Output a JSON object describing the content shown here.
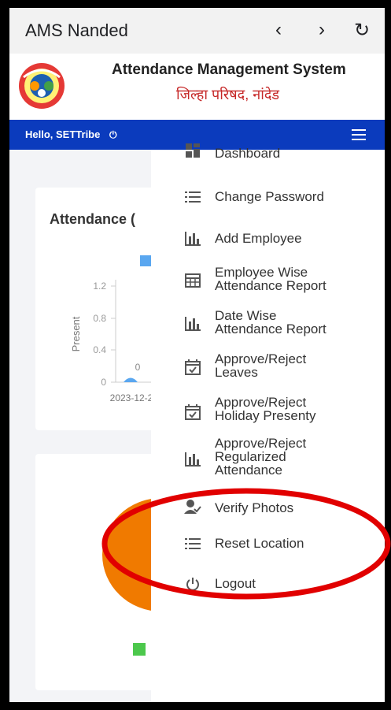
{
  "browser": {
    "title": "AMS Nanded",
    "back_glyph": "‹",
    "forward_glyph": "›",
    "reload_glyph": "↻"
  },
  "header": {
    "title": "Attendance Management System",
    "subtitle": "जिल्हा परिषद, नांदेड"
  },
  "topbar": {
    "greeting": "Hello, SETTribe",
    "power_glyph": "⏻"
  },
  "background": {
    "card_title": "Attendance (",
    "chart": {
      "y_ticks": [
        "1.2",
        "0.8",
        "0.4",
        "0"
      ],
      "ylabel": "Present",
      "x_tick": "2023-12-2",
      "point_label": "0"
    }
  },
  "menu": {
    "items": [
      {
        "icon": "dashboard-icon",
        "label": "Dashboard"
      },
      {
        "icon": "list-icon",
        "label": "Change Password"
      },
      {
        "icon": "bar-chart-icon",
        "label": "Add Employee"
      },
      {
        "icon": "table-icon",
        "label": "Employee Wise\nAttendance Report"
      },
      {
        "icon": "bar-chart-icon",
        "label": "Date Wise\nAttendance Report"
      },
      {
        "icon": "calendar-check-icon",
        "label": "Approve/Reject\nLeaves"
      },
      {
        "icon": "calendar-check-icon",
        "label": "Approve/Reject\nHoliday Presenty"
      },
      {
        "icon": "bar-chart-icon",
        "label": "Approve/Reject\nRegularized\nAttendance"
      },
      {
        "icon": "user-check-icon",
        "label": "Verify Photos"
      },
      {
        "icon": "list-icon",
        "label": "Reset Location"
      },
      {
        "icon": "power-icon",
        "label": "Logout"
      }
    ]
  },
  "colors": {
    "accent_blue": "#0b3bbd",
    "annotation_red": "#e10000",
    "chart_orange": "#f07a00",
    "legend_blue": "#5aa7f0",
    "legend_green": "#4cc84c"
  }
}
